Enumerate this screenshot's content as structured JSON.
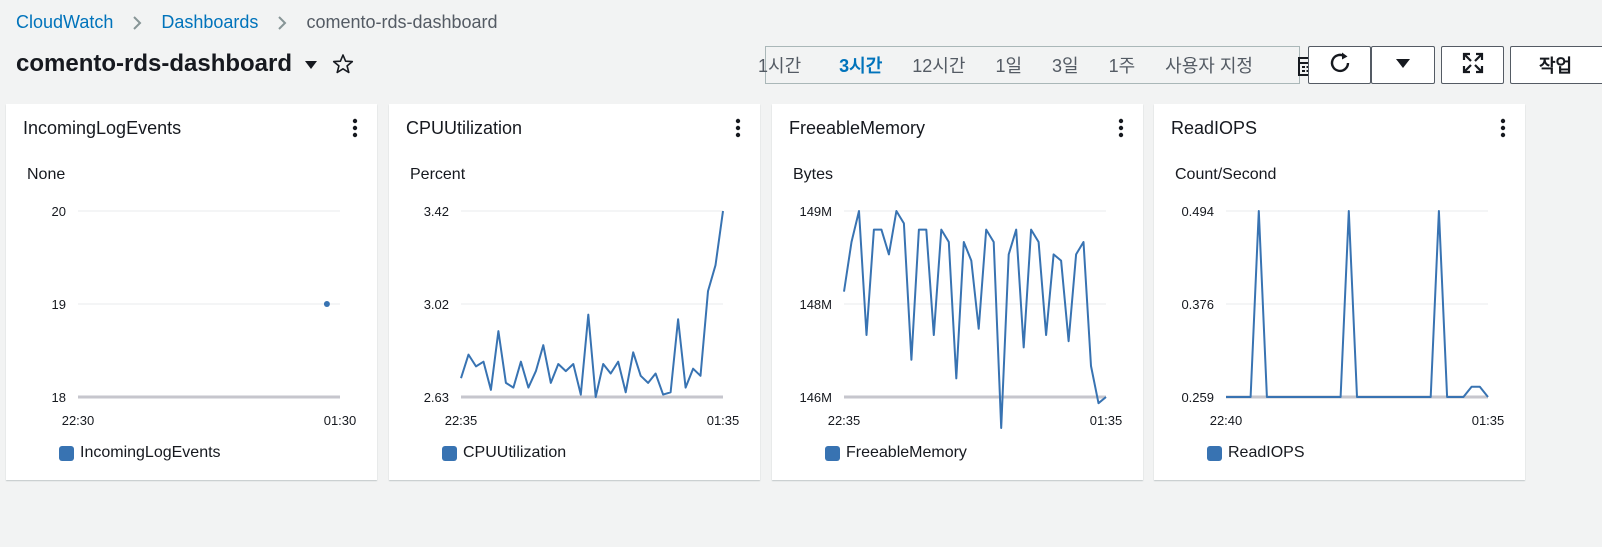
{
  "breadcrumb": {
    "root": "CloudWatch",
    "section": "Dashboards",
    "current": "comento-rds-dashboard"
  },
  "title": "comento-rds-dashboard",
  "time_range": {
    "options": [
      "1시간",
      "3시간",
      "12시간",
      "1일",
      "3일",
      "1주",
      "사용자 지정"
    ],
    "active": "3시간"
  },
  "toolbar": {
    "action_label": "작업",
    "icons": [
      "refresh-icon",
      "caret-down-icon",
      "fullscreen-icon",
      "calendar-icon"
    ]
  },
  "colors": {
    "series": "#3873b2",
    "link": "#0073bb"
  },
  "widgets": [
    {
      "title": "IncomingLogEvents",
      "unit": "None",
      "legend": "IncomingLogEvents"
    },
    {
      "title": "CPUUtilization",
      "unit": "Percent",
      "legend": "CPUUtilization"
    },
    {
      "title": "FreeableMemory",
      "unit": "Bytes",
      "legend": "FreeableMemory"
    },
    {
      "title": "ReadIOPS",
      "unit": "Count/Second",
      "legend": "ReadIOPS"
    }
  ],
  "chart_data": [
    {
      "type": "scatter",
      "title": "IncomingLogEvents",
      "ylabel": "None",
      "yticks": [
        "20",
        "19",
        "18"
      ],
      "ylim": [
        18,
        20
      ],
      "xticks": [
        "22:30",
        "01:30"
      ],
      "series": [
        {
          "name": "IncomingLogEvents",
          "points": [
            [
              0.95,
              19
            ]
          ]
        }
      ]
    },
    {
      "type": "line",
      "title": "CPUUtilization",
      "ylabel": "Percent",
      "yticks": [
        "3.42",
        "3.02",
        "2.63"
      ],
      "ylim": [
        2.63,
        3.42
      ],
      "xticks": [
        "22:35",
        "01:35"
      ],
      "series": [
        {
          "name": "CPUUtilization",
          "values": [
            2.71,
            2.81,
            2.76,
            2.78,
            2.66,
            2.91,
            2.69,
            2.67,
            2.78,
            2.67,
            2.74,
            2.85,
            2.69,
            2.77,
            2.74,
            2.77,
            2.64,
            2.98,
            2.63,
            2.77,
            2.73,
            2.78,
            2.65,
            2.82,
            2.72,
            2.69,
            2.73,
            2.64,
            2.65,
            2.96,
            2.67,
            2.75,
            2.72,
            3.08,
            3.19,
            3.42
          ]
        }
      ]
    },
    {
      "type": "line",
      "title": "FreeableMemory",
      "ylabel": "Bytes",
      "yticks": [
        "149M",
        "148M",
        "146M"
      ],
      "ylim": [
        146,
        149
      ],
      "xticks": [
        "22:35",
        "01:35"
      ],
      "series": [
        {
          "name": "FreeableMemory",
          "values": [
            147.7,
            148.5,
            149.0,
            147.0,
            148.7,
            148.7,
            148.3,
            149.0,
            148.8,
            146.6,
            148.7,
            148.7,
            147.0,
            148.7,
            148.5,
            146.3,
            148.5,
            148.2,
            147.1,
            148.7,
            148.5,
            145.5,
            148.3,
            148.7,
            146.8,
            148.7,
            148.5,
            147.0,
            148.3,
            148.2,
            146.9,
            148.3,
            148.5,
            146.5,
            145.9,
            146.0
          ]
        }
      ]
    },
    {
      "type": "line",
      "title": "ReadIOPS",
      "ylabel": "Count/Second",
      "yticks": [
        "0.494",
        "0.376",
        "0.259"
      ],
      "ylim": [
        0.259,
        0.494
      ],
      "xticks": [
        "22:40",
        "01:35"
      ],
      "series": [
        {
          "name": "ReadIOPS",
          "values": [
            0.259,
            0.259,
            0.259,
            0.259,
            0.494,
            0.259,
            0.259,
            0.259,
            0.259,
            0.259,
            0.259,
            0.259,
            0.259,
            0.259,
            0.259,
            0.494,
            0.259,
            0.259,
            0.259,
            0.259,
            0.259,
            0.259,
            0.259,
            0.259,
            0.259,
            0.259,
            0.494,
            0.259,
            0.259,
            0.259,
            0.272,
            0.272,
            0.259
          ]
        }
      ]
    }
  ]
}
